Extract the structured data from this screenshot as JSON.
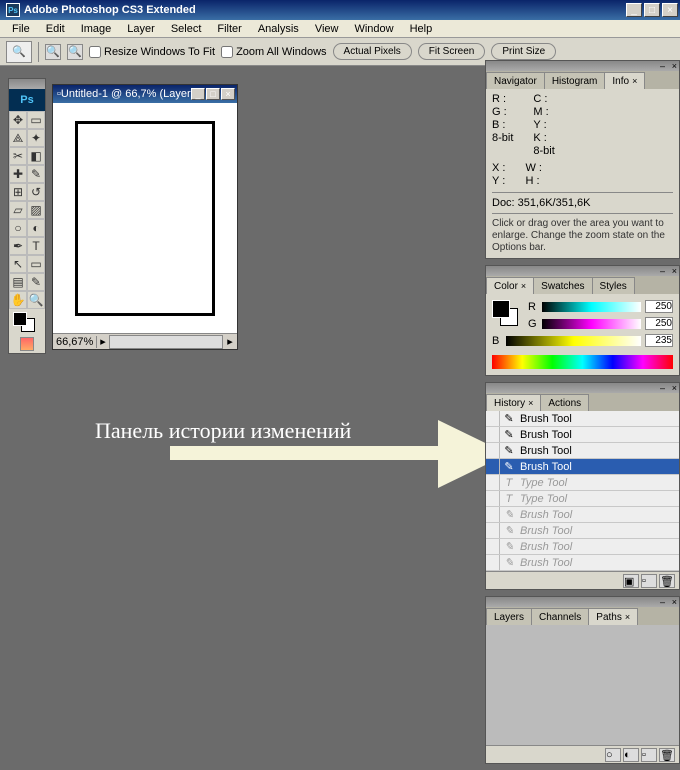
{
  "titlebar": {
    "app_icon": "Ps",
    "title": "Adobe Photoshop CS3 Extended"
  },
  "menu": [
    "File",
    "Edit",
    "Image",
    "Layer",
    "Select",
    "Filter",
    "Analysis",
    "View",
    "Window",
    "Help"
  ],
  "options": {
    "resize_windows": "Resize Windows To Fit",
    "zoom_all": "Zoom All Windows",
    "actual_pixels": "Actual Pixels",
    "fit_screen": "Fit Screen",
    "print_size": "Print Size"
  },
  "document": {
    "title": "Untitled-1 @ 66,7% (Layer ...",
    "zoom": "66,67%"
  },
  "annotation": "Панель истории изменений",
  "info_panel": {
    "tabs": [
      "Navigator",
      "Histogram",
      "Info"
    ],
    "active": 2,
    "r": "R :",
    "g": "G :",
    "b": "B :",
    "c": "C :",
    "m": "M :",
    "y": "Y :",
    "k": "K :",
    "bit": "8-bit",
    "x": "X :",
    "w": "W :",
    "h": "H :",
    "doc": "Doc: 351,6K/351,6K",
    "hint": "Click or drag over the area you want to enlarge. Change the zoom state on the Options bar."
  },
  "color_panel": {
    "tabs": [
      "Color",
      "Swatches",
      "Styles"
    ],
    "r": 250,
    "g": 250,
    "b": 235
  },
  "history_panel": {
    "tabs": [
      "History",
      "Actions"
    ],
    "items": [
      {
        "label": "Brush Tool",
        "type": "brush",
        "state": "normal"
      },
      {
        "label": "Brush Tool",
        "type": "brush",
        "state": "normal"
      },
      {
        "label": "Brush Tool",
        "type": "brush",
        "state": "normal"
      },
      {
        "label": "Brush Tool",
        "type": "brush",
        "state": "selected"
      },
      {
        "label": "Type Tool",
        "type": "type",
        "state": "dimmed"
      },
      {
        "label": "Type Tool",
        "type": "type",
        "state": "dimmed"
      },
      {
        "label": "Brush Tool",
        "type": "brush",
        "state": "dimmed"
      },
      {
        "label": "Brush Tool",
        "type": "brush",
        "state": "dimmed"
      },
      {
        "label": "Brush Tool",
        "type": "brush",
        "state": "dimmed"
      },
      {
        "label": "Brush Tool",
        "type": "brush",
        "state": "dimmed"
      }
    ]
  },
  "layers_panel": {
    "tabs": [
      "Layers",
      "Channels",
      "Paths"
    ]
  },
  "ps_logo": "Ps"
}
